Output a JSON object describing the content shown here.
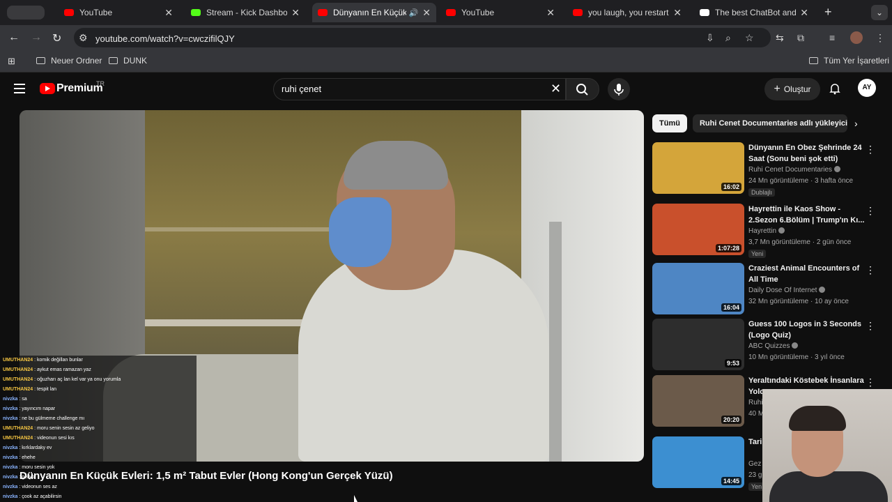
{
  "browser": {
    "tabs": [
      {
        "label": "YouTube",
        "favicon_color": "#ff0000",
        "active": false
      },
      {
        "label": "Stream - Kick Dashboard",
        "favicon_color": "#53fc18",
        "active": false
      },
      {
        "label": "Dünyanın En Küçük E",
        "favicon_color": "#ff0000",
        "active": true
      },
      {
        "label": "YouTube",
        "favicon_color": "#ff0000",
        "active": false
      },
      {
        "label": "you laugh, you restart - ",
        "favicon_color": "#ff0000",
        "active": false
      },
      {
        "label": "The best ChatBot and W",
        "favicon_color": "#ffffff",
        "active": false
      }
    ],
    "url": "youtube.com/watch?v=cwczifilQJY",
    "bookmarks": [
      "Neuer Ordner",
      "DUNK"
    ],
    "all_bookmarks": "Tüm Yer İşaretleri"
  },
  "youtube": {
    "logo": "Premium",
    "logo_country": "TR",
    "search_value": "ruhi çenet",
    "create_label": "Oluştur",
    "avatar_initials": "AY"
  },
  "video": {
    "title": "Dünyanın En Küçük Evleri: 1,5 m² Tabut Evler (Hong Kong'un Gerçek Yüzü)"
  },
  "chat": [
    {
      "user": "UMUTHAN24",
      "msg": "komik değillan bunlar",
      "type": "u1"
    },
    {
      "user": "UMUTHAN24",
      "msg": "aykut emas ramazan yaz",
      "type": "u1"
    },
    {
      "user": "UMUTHAN24",
      "msg": "oğuzharı aç lan kel var ya onu yorumla",
      "type": "u1"
    },
    {
      "user": "UMUTHAN24",
      "msg": "tespit lan",
      "type": "u1"
    },
    {
      "user": "nivzka",
      "msg": "sa",
      "type": "u2"
    },
    {
      "user": "nivzka",
      "msg": "yayıncım napar",
      "type": "u2"
    },
    {
      "user": "nivzka",
      "msg": "ne bu gülmeme challenge mı",
      "type": "u2"
    },
    {
      "user": "UMUTHAN24",
      "msg": "moru senin sesin az geliyo",
      "type": "u1"
    },
    {
      "user": "UMUTHAN24",
      "msg": "videonun sesi kıs",
      "type": "u1"
    },
    {
      "user": "nivzka",
      "msg": "kırklardaky ev",
      "type": "u2"
    },
    {
      "user": "nivzka",
      "msg": "ehehe",
      "type": "u2"
    },
    {
      "user": "nivzka",
      "msg": "moru sesin yok",
      "type": "u2"
    },
    {
      "user": "nivzka",
      "msg": "geliyo",
      "type": "u2"
    },
    {
      "user": "nivzka",
      "msg": "videonun ses az",
      "type": "u2"
    },
    {
      "user": "nivzka",
      "msg": "çook az açabilirsin",
      "type": "u2"
    }
  ],
  "chips": [
    "Tümü",
    "Ruhi Cenet Documentaries adlı yükleyiciden"
  ],
  "recommendations": [
    {
      "title": "Dünyanın En Obez Şehrinde 24 Saat (Sonu beni şok etti)",
      "channel": "Ruhi Cenet Documentaries",
      "meta": "24 Mn görüntüleme · 3 hafta önce",
      "badge": "Dublajlı",
      "duration": "16:02",
      "thumb": "#d4a53a"
    },
    {
      "title": "Hayrettin ile Kaos Show - 2.Sezon 6.Bölüm | Trump'ın Kı...",
      "channel": "Hayrettin",
      "meta": "3,7 Mn görüntüleme · 2 gün önce",
      "badge": "Yeni",
      "duration": "1:07:28",
      "thumb": "#c9502c"
    },
    {
      "title": "Craziest Animal Encounters of All Time",
      "channel": "Daily Dose Of Internet",
      "meta": "32 Mn görüntüleme · 10 ay önce",
      "badge": "",
      "duration": "16:04",
      "thumb": "#4e86c4"
    },
    {
      "title": "Guess 100 Logos in 3 Seconds (Logo Quiz)",
      "channel": "ABC Quizzes",
      "meta": "10 Mn görüntüleme · 3 yıl önce",
      "badge": "",
      "duration": "9:53",
      "thumb": "#2d2d2d"
    },
    {
      "title": "Yeraltındaki Köstebek İnsanlara Yolc...",
      "channel": "Ruhi",
      "meta": "40 M",
      "badge": "",
      "duration": "20:20",
      "thumb": "#6b5a4a"
    },
    {
      "title": "Tari Gaz",
      "channel": "Gez",
      "meta": "23 g",
      "badge": "Yen",
      "duration": "14:45",
      "thumb": "#3c8fd1"
    }
  ]
}
